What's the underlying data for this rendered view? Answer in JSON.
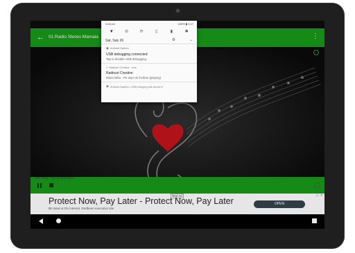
{
  "app_bar": {
    "title": "01.Radio Stereo Mamaia"
  },
  "player": {
    "now_playing": "Hit's Real - Evil on the dance"
  },
  "ad": {
    "badge": "Test Ad",
    "headline": "Protect Now, Pay Later - Protect Now, Pay Later",
    "subtext": "$0 down & 0% interest. Redbeen executive site",
    "open_label": "OPEN",
    "ad_icons": "▷ ✕"
  },
  "notification_shade": {
    "carrier": "Android",
    "battery": "100%",
    "time": "1:17",
    "date": "Sat, Sep 26",
    "quick_settings": [
      {
        "icon": "wifi-icon",
        "glyph": "▼"
      },
      {
        "icon": "dnd-icon",
        "glyph": "⊘"
      },
      {
        "icon": "autorotate-icon",
        "glyph": "⟳"
      },
      {
        "icon": "battery-icon",
        "glyph": "▯"
      },
      {
        "icon": "flashlight-icon",
        "glyph": "▮"
      },
      {
        "icon": "bluetooth-icon",
        "glyph": "✱"
      }
    ],
    "notifications": [
      {
        "app": "Android System",
        "title": "USB debugging connected",
        "text": "Tap to disable USB debugging."
      },
      {
        "app": "Radiouri Crestine · now",
        "title": "Radiouri Crestine",
        "text": "Maria Mihu - Pe anpr do încântu (playing)"
      }
    ],
    "footer": "Android System • USB charging this device ▾"
  }
}
